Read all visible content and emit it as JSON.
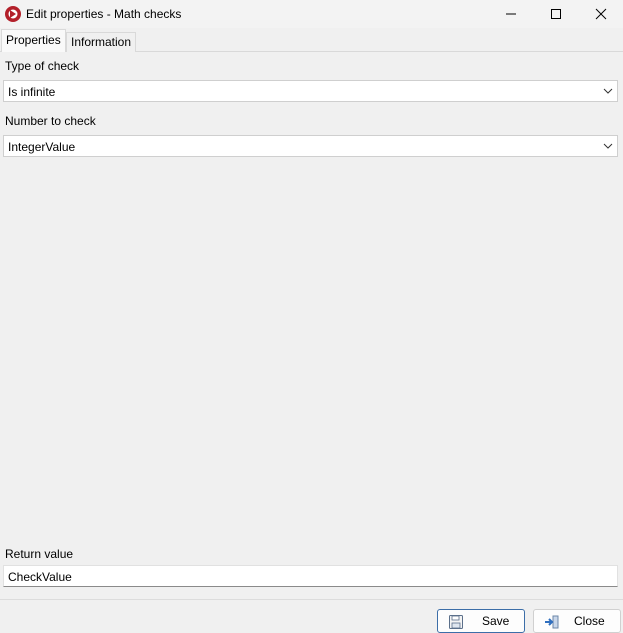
{
  "window": {
    "title": "Edit properties - Math checks",
    "controls": {
      "minimize_icon": "minimize-icon",
      "maximize_icon": "maximize-icon",
      "close_icon": "close-icon"
    }
  },
  "tabs": [
    {
      "label": "Properties",
      "active": true
    },
    {
      "label": "Information",
      "active": false
    }
  ],
  "fields": {
    "type_of_check": {
      "label": "Type of check",
      "value": "Is infinite"
    },
    "number_to_check": {
      "label": "Number to check",
      "value": "IntegerValue"
    },
    "return_value": {
      "label": "Return value",
      "value": "CheckValue"
    }
  },
  "buttons": {
    "save": {
      "label": "Save",
      "icon": "floppy-disk-icon"
    },
    "close": {
      "label": "Close",
      "icon": "exit-arrow-icon"
    }
  },
  "colors": {
    "accent_border": "#3c6ea8",
    "app_icon_red": "#b3202a"
  }
}
